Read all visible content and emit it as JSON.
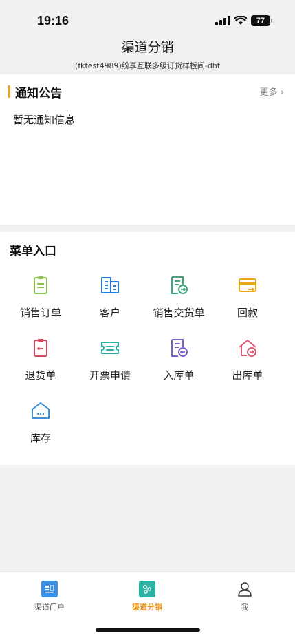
{
  "status": {
    "time": "19:16",
    "battery": "77"
  },
  "header": {
    "title": "渠道分销",
    "subtitle": "(fktest4989)纷享互联多级订货样板间-dht"
  },
  "notice": {
    "title": "通知公告",
    "more": "更多 ›",
    "empty": "暂无通知信息"
  },
  "menu": {
    "title": "菜单入口",
    "items": [
      {
        "label": "销售订单",
        "icon": "clipboard-icon",
        "color": "#8cc152"
      },
      {
        "label": "客户",
        "icon": "building-icon",
        "color": "#2f7ad6"
      },
      {
        "label": "销售交货单",
        "icon": "delivery-doc-icon",
        "color": "#3aa87a"
      },
      {
        "label": "回款",
        "icon": "payment-card-icon",
        "color": "#e6a817"
      },
      {
        "label": "退货单",
        "icon": "return-clipboard-icon",
        "color": "#d9485f"
      },
      {
        "label": "开票申请",
        "icon": "ticket-icon",
        "color": "#2bb3a3"
      },
      {
        "label": "入库单",
        "icon": "inbound-doc-icon",
        "color": "#7b5fc9"
      },
      {
        "label": "出库单",
        "icon": "outbound-house-icon",
        "color": "#e05a73"
      },
      {
        "label": "库存",
        "icon": "warehouse-icon",
        "color": "#3d8fd6"
      }
    ]
  },
  "tabs": [
    {
      "label": "渠道门户",
      "icon": "portal-icon",
      "color": "#3d8fe0"
    },
    {
      "label": "渠道分销",
      "icon": "distribution-icon",
      "color": "#2bb3a3"
    },
    {
      "label": "我",
      "icon": "person-icon",
      "color": "#333333"
    }
  ],
  "accent": "#f0a020"
}
